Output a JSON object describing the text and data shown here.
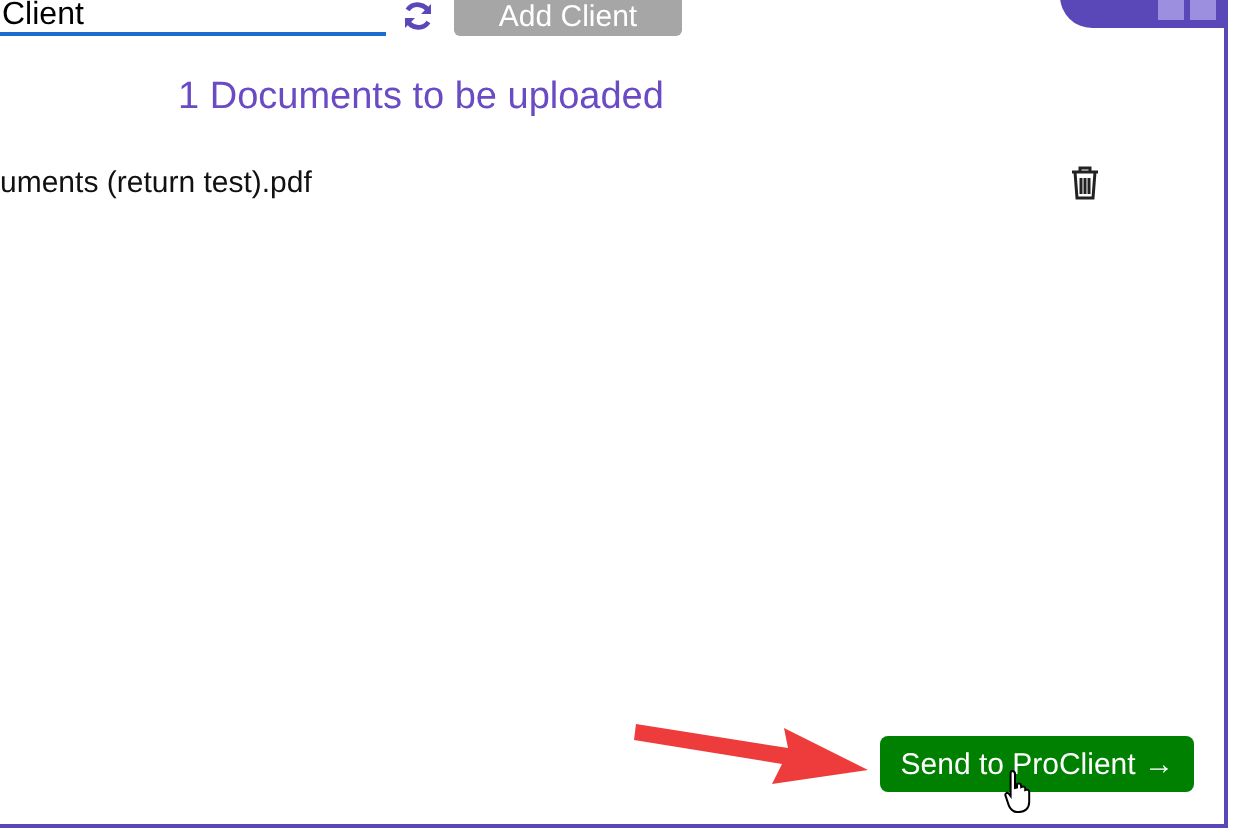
{
  "client_field": {
    "value": "Client"
  },
  "add_client_button": {
    "label": "Add Client",
    "disabled": true
  },
  "heading": "1 Documents to be uploaded",
  "documents": [
    {
      "name": "uments (return test).pdf"
    }
  ],
  "send_button": {
    "label": "Send to ProClient →"
  }
}
